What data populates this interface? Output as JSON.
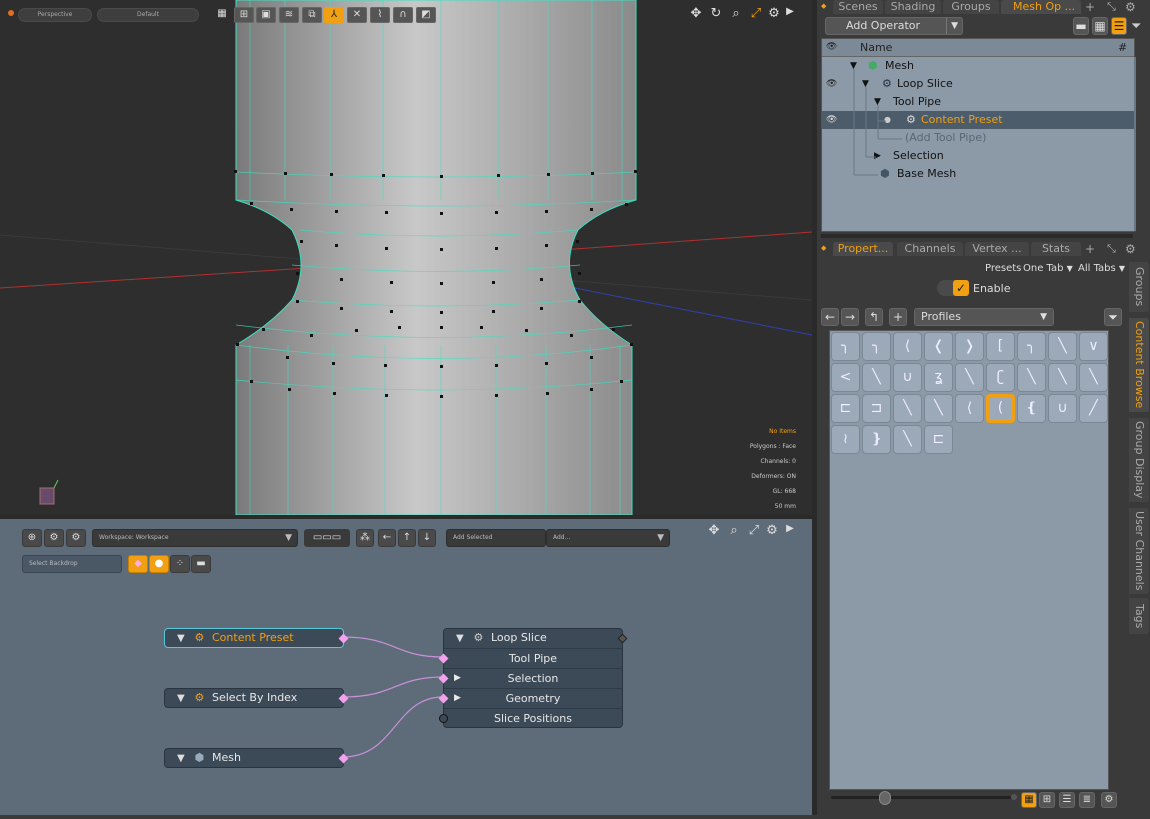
{
  "viewport": {
    "view_mode": "Perspective",
    "shading": "Default",
    "info": {
      "items": "No Items",
      "polygons": "Polygons : Face",
      "channels": "Channels: 0",
      "deformers": "Deformers: ON",
      "gl": "GL: 668",
      "scale": "50 mm"
    }
  },
  "schematic": {
    "workspace": "Workspace: Workspace",
    "add_selected": "Add Selected",
    "add": "Add...",
    "backdrop": "Select Backdrop",
    "nodes": {
      "content_preset": "Content Preset",
      "select_by_index": "Select By Index",
      "mesh": "Mesh",
      "loop_slice": {
        "title": "Loop Slice",
        "rows": [
          "Tool Pipe",
          "Selection",
          "Geometry",
          "Slice Positions"
        ]
      }
    }
  },
  "top_tabs": [
    "Scenes",
    "Shading",
    "Groups",
    "Mesh Op ..."
  ],
  "mesh_ops": {
    "add_operator": "Add Operator",
    "col_name": "Name",
    "col_hash": "#",
    "tree": [
      "Mesh",
      "Loop Slice",
      "Tool Pipe",
      "Content Preset",
      "(Add Tool Pipe)",
      "Selection",
      "Base Mesh"
    ]
  },
  "bottom_tabs": [
    "Propert...",
    "Channels",
    "Vertex ...",
    "Stats"
  ],
  "props": {
    "presets": "Presets",
    "one_tab": "One Tab",
    "all_tabs": "All Tabs",
    "enable": "Enable",
    "profiles": "Profiles"
  },
  "side_tabs": [
    "Groups",
    "Content Browse",
    "Group Display",
    "User Channels",
    "Tags"
  ],
  "colors": {
    "accent": "#f0a010",
    "wire": "#3ee0c0",
    "port": "#f5a0ee"
  }
}
